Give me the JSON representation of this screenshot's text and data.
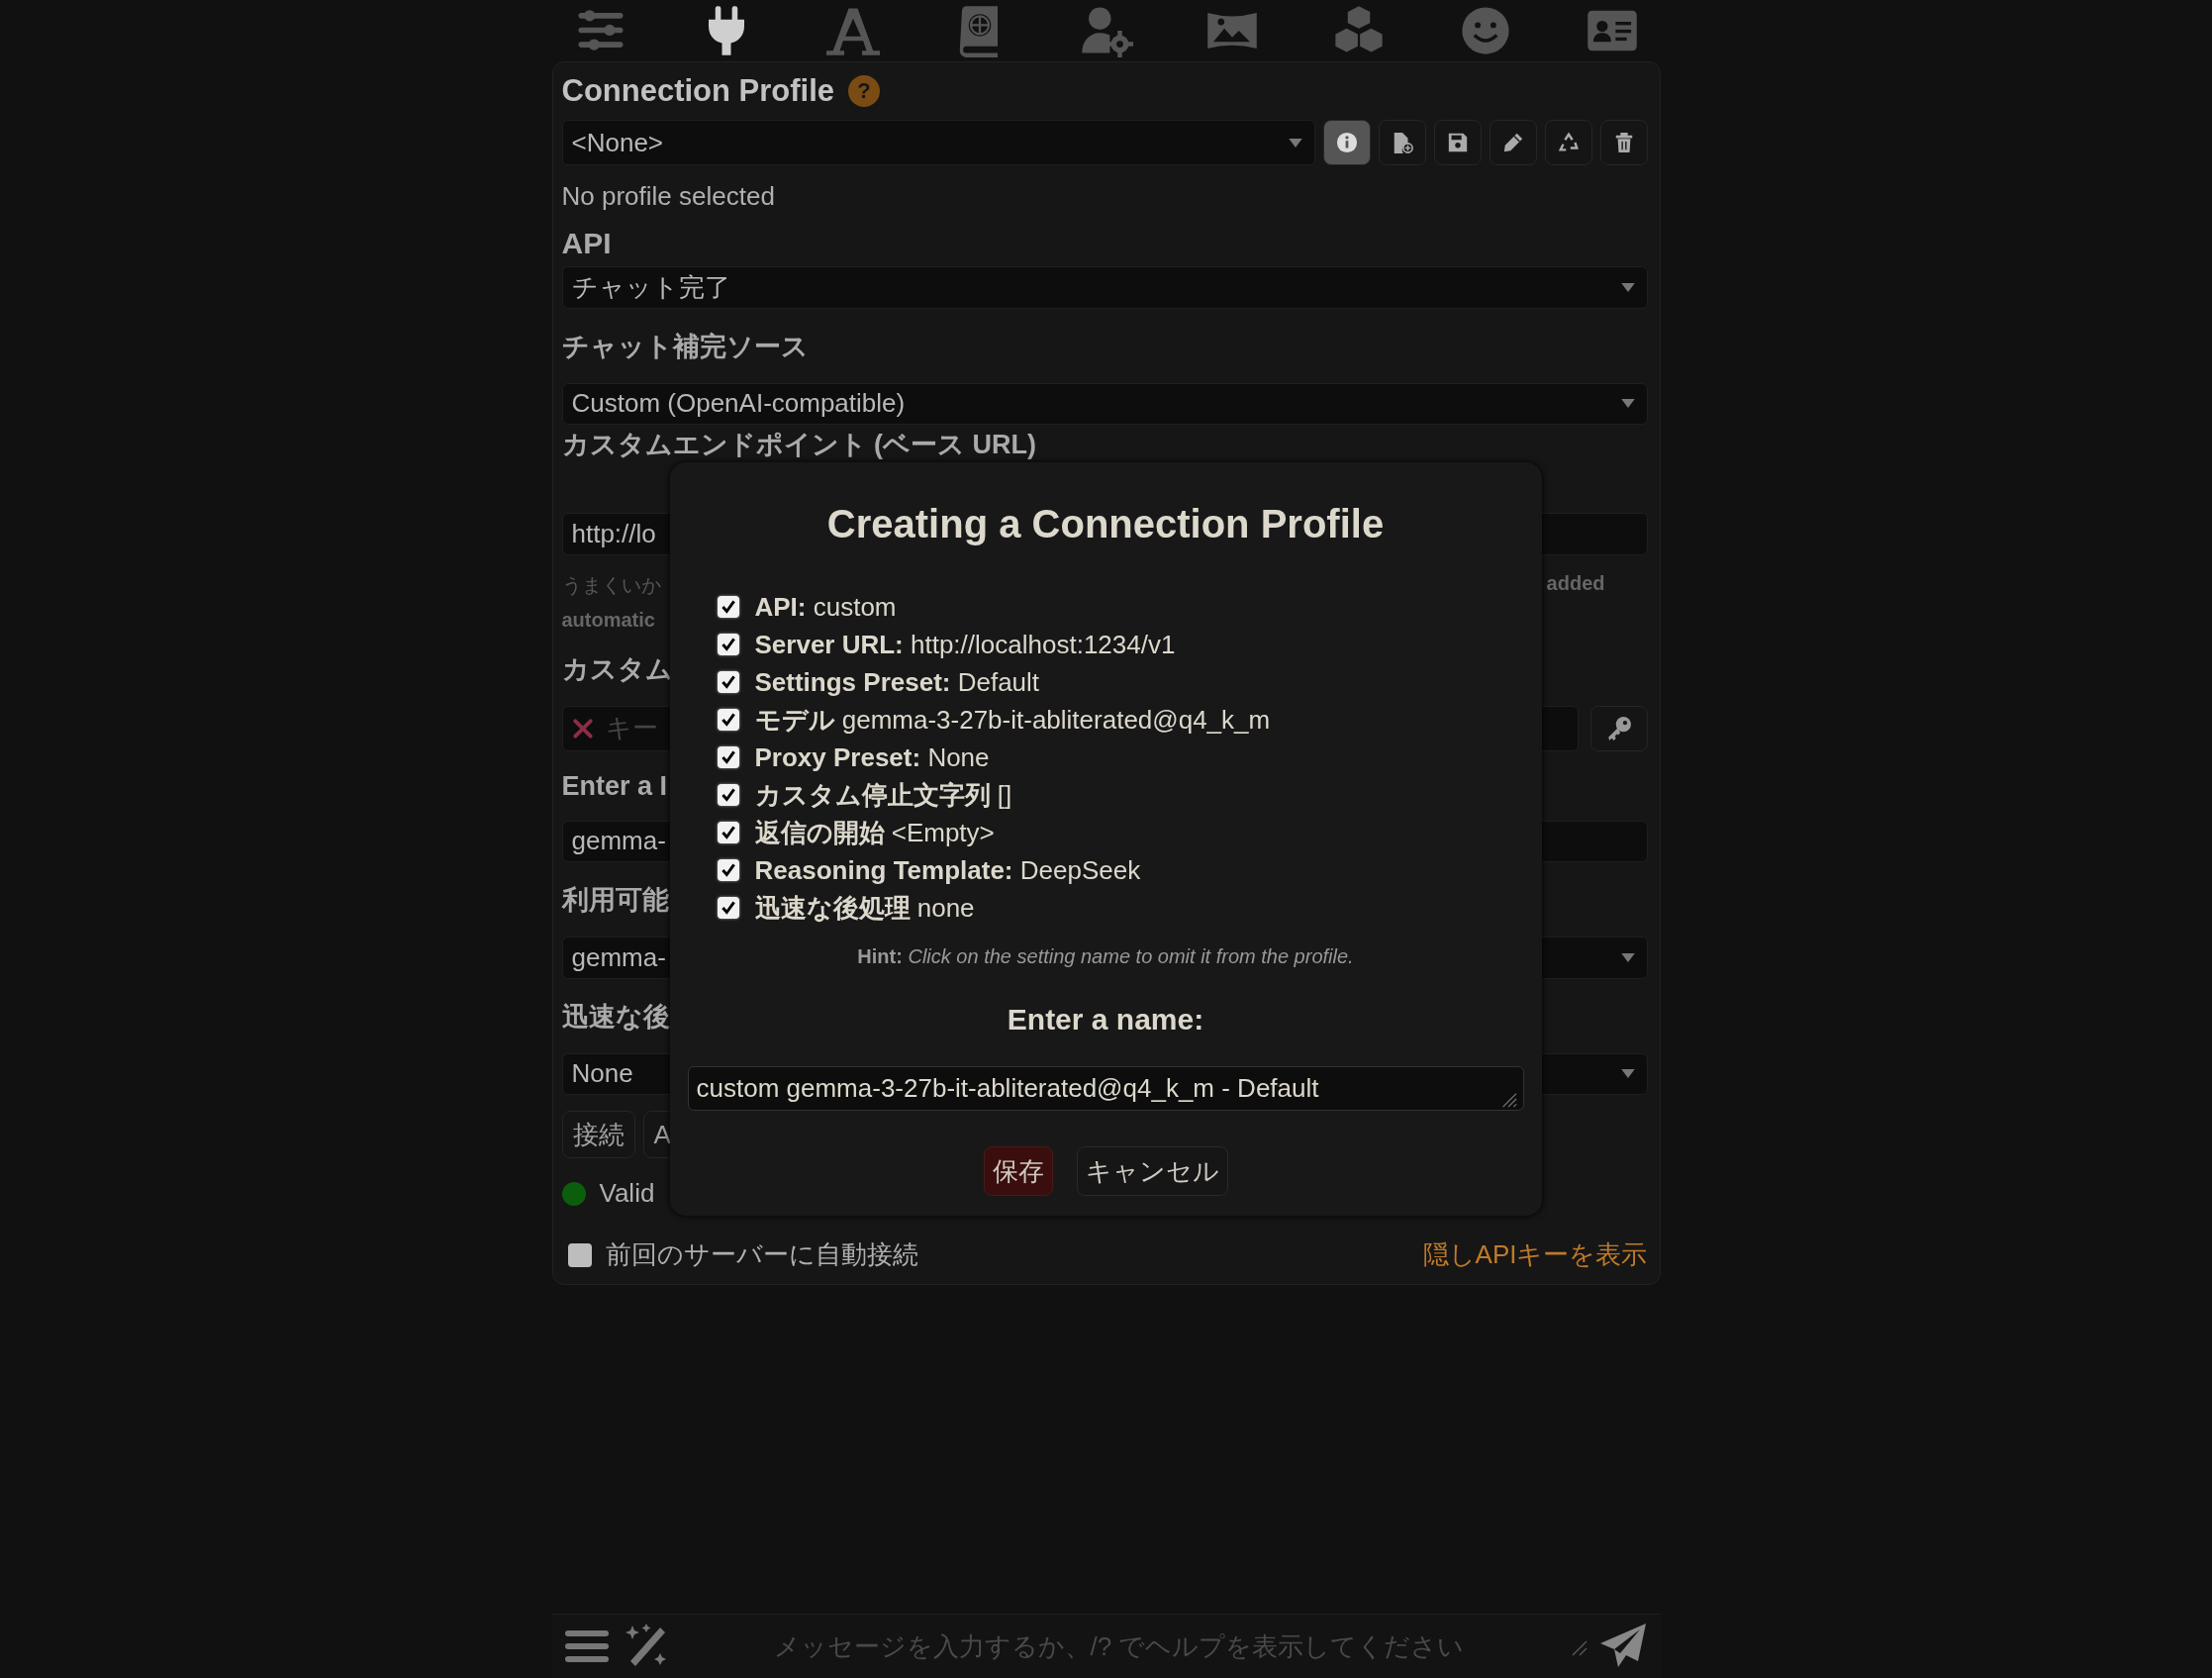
{
  "nav_tabs": [
    {
      "selected": false
    },
    {
      "selected": true
    },
    {
      "selected": false
    },
    {
      "selected": false
    },
    {
      "selected": false
    },
    {
      "selected": false
    },
    {
      "selected": false
    },
    {
      "selected": false
    },
    {
      "selected": false
    }
  ],
  "connection_profile": {
    "title": "Connection Profile",
    "help_badge": "?",
    "value": "<None>",
    "actions": [
      {
        "selected": true
      },
      {
        "selected": false
      },
      {
        "selected": false
      },
      {
        "selected": false
      },
      {
        "selected": false
      },
      {
        "selected": false
      }
    ],
    "status": "No profile selected"
  },
  "api": {
    "label": "API",
    "value": "チャット完了"
  },
  "chat_completion_source": {
    "label": "チャット補完ソース",
    "value": "Custom (OpenAI-compatible)"
  },
  "custom_endpoint": {
    "label": "カスタムエンドポイント (ベース URL)",
    "value": "http://lo",
    "hint": "うまくいか",
    "hint_end": "added",
    "note": "automatic"
  },
  "custom_key": {
    "label": "カスタム",
    "placeholder": "キー"
  },
  "model_id": {
    "label": "Enter a I",
    "value": "gemma-"
  },
  "available_models": {
    "label": "利用可能",
    "value": "gemma-"
  },
  "post_processing": {
    "label": "迅速な後",
    "value": "None"
  },
  "buttons": [
    "接続",
    "A"
  ],
  "connection_status": {
    "text": "Valid",
    "color": "#0b5e0b"
  },
  "auto_connect": {
    "label": "前回のサーバーに自動接続",
    "checked": false
  },
  "show_keys_link": "隠しAPIキーを表示",
  "dialog": {
    "title": "Creating a Connection Profile",
    "settings": [
      {
        "name": "API:",
        "value": "custom",
        "checked": true
      },
      {
        "name": "Server URL:",
        "value": "http://localhost:1234/v1",
        "checked": true
      },
      {
        "name": "Settings Preset:",
        "value": "Default",
        "checked": true
      },
      {
        "name": "モデル",
        "value": "gemma-3-27b-it-abliterated@q4_k_m",
        "checked": true
      },
      {
        "name": "Proxy Preset:",
        "value": "None",
        "checked": true
      },
      {
        "name": "カスタム停止文字列",
        "value": "[]",
        "checked": true
      },
      {
        "name": "返信の開始",
        "value": "<Empty>",
        "checked": true
      },
      {
        "name": "Reasoning Template:",
        "value": "DeepSeek",
        "checked": true
      },
      {
        "name": "迅速な後処理",
        "value": "none",
        "checked": true
      }
    ],
    "hint": "**Hint:** *Click on the setting name to omit it from the profile.*",
    "name_label": "Enter a name:",
    "name_value": "custom gemma-3-27b-it-abliterated@q4_k_m - Default",
    "buttons": [
      "保存",
      "キャンセル"
    ]
  },
  "chat_input": {
    "placeholder": "メッセージを入力するか、/? でヘルプを表示してください"
  }
}
